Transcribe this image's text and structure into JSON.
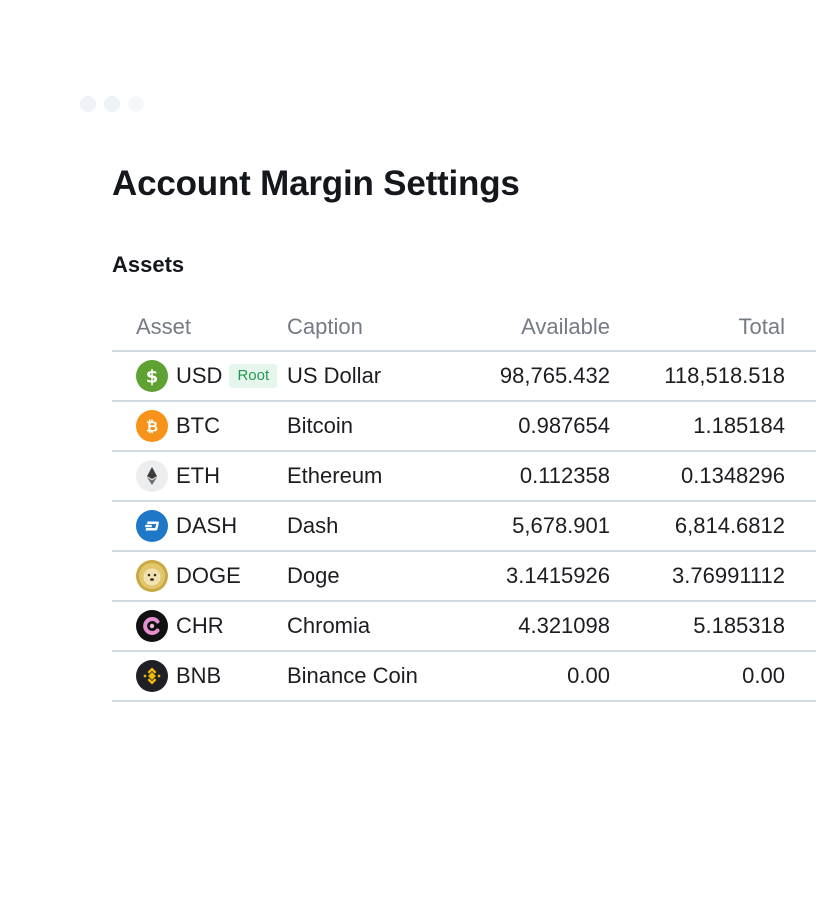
{
  "page": {
    "title": "Account Margin Settings",
    "section_title": "Assets"
  },
  "table": {
    "headers": {
      "asset": "Asset",
      "caption": "Caption",
      "available": "Available",
      "total": "Total"
    },
    "rows": [
      {
        "ticker": "USD",
        "badge": "Root",
        "caption": "US Dollar",
        "available": "98,765.432",
        "total": "118,518.518",
        "icon": "dollar-coin-icon",
        "color": "#5fa132"
      },
      {
        "ticker": "BTC",
        "caption": "Bitcoin",
        "available": "0.987654",
        "total": "1.185184",
        "icon": "bitcoin-icon",
        "color": "#f7931a"
      },
      {
        "ticker": "ETH",
        "caption": "Ethereum",
        "available": "0.112358",
        "total": "0.1348296",
        "icon": "ethereum-icon",
        "color": "#ecedef"
      },
      {
        "ticker": "DASH",
        "caption": "Dash",
        "available": "5,678.901",
        "total": "6,814.6812",
        "icon": "dash-icon",
        "color": "#1f77c8"
      },
      {
        "ticker": "DOGE",
        "caption": "Doge",
        "available": "3.1415926",
        "total": "3.76991112",
        "icon": "dogecoin-icon",
        "color": "#c9a942"
      },
      {
        "ticker": "CHR",
        "caption": "Chromia",
        "available": "4.321098",
        "total": "5.185318",
        "icon": "chromia-icon",
        "color": "#111111"
      },
      {
        "ticker": "BNB",
        "caption": "Binance Coin",
        "available": "0.00",
        "total": "0.00",
        "icon": "binance-coin-icon",
        "color": "#1e2026"
      }
    ]
  }
}
